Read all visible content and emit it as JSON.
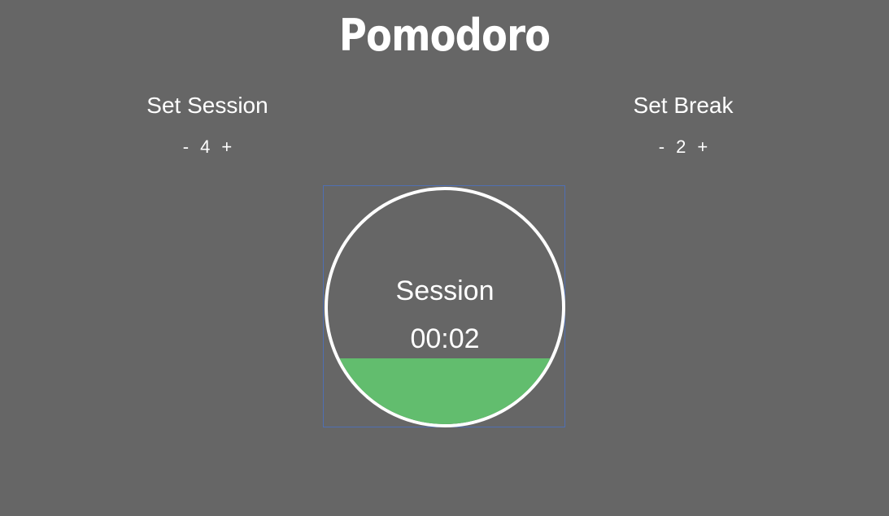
{
  "app": {
    "title": "Pomodoro"
  },
  "session_setter": {
    "label": "Set Session",
    "decrement": "-",
    "value": "4",
    "increment": "+"
  },
  "break_setter": {
    "label": "Set Break",
    "decrement": "-",
    "value": "2",
    "increment": "+"
  },
  "timer": {
    "mode_label": "Session",
    "time": "00:02",
    "progress_fraction": 0.28
  },
  "colors": {
    "background": "#666666",
    "text": "#ffffff",
    "progress_fill": "#62bd6e",
    "focus_outline": "#4f6fb3"
  }
}
